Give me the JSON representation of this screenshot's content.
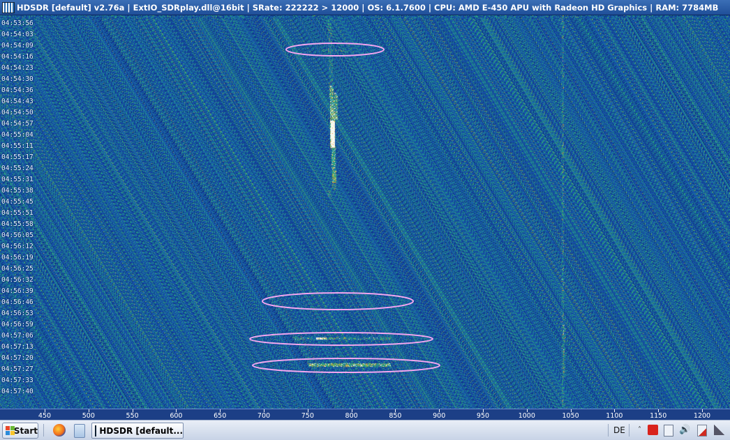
{
  "window": {
    "title": "HDSDR  [default]  v2.76a   |  ExtIO_SDRplay.dll@16bit   |  SRate: 222222 > 12000   |  OS: 6.1.7600    |  CPU: AMD E-450 APU with Radeon HD Graphics   |  RAM: 7784MB"
  },
  "waterfall": {
    "time_labels": [
      "04:53:56",
      "04:54:03",
      "04:54:09",
      "04:54:16",
      "04:54:23",
      "04:54:30",
      "04:54:36",
      "04:54:43",
      "04:54:50",
      "04:54:57",
      "04:55:04",
      "04:55:11",
      "04:55:17",
      "04:55:24",
      "04:55:31",
      "04:55:38",
      "04:55:45",
      "04:55:51",
      "04:55:58",
      "04:56:05",
      "04:56:12",
      "04:56:19",
      "04:56:25",
      "04:56:32",
      "04:56:39",
      "04:56:46",
      "04:56:53",
      "04:56:59",
      "04:57:06",
      "04:57:13",
      "04:57:20",
      "04:57:27",
      "04:57:33",
      "04:57:40"
    ],
    "freq_labels": [
      "450",
      "500",
      "550",
      "600",
      "650",
      "700",
      "750",
      "800",
      "850",
      "900",
      "950",
      "1000",
      "1050",
      "1100",
      "1150",
      "1200"
    ],
    "highlight_color": "#f2a6f0",
    "palette": {
      "low": "#0a2d7a",
      "mid": "#1f7aa8",
      "high": "#f5a623",
      "peak": "#ffffff"
    }
  },
  "taskbar": {
    "start_label": "Start",
    "task_label": "HDSDR  [default...",
    "language": "DE",
    "icons": [
      "firefox-icon",
      "notepad-icon",
      "hdsdr-icon",
      "show-hidden-icons-icon",
      "avira-icon",
      "network-icon",
      "volume-icon",
      "action-center-icon",
      "signal-icon"
    ]
  }
}
